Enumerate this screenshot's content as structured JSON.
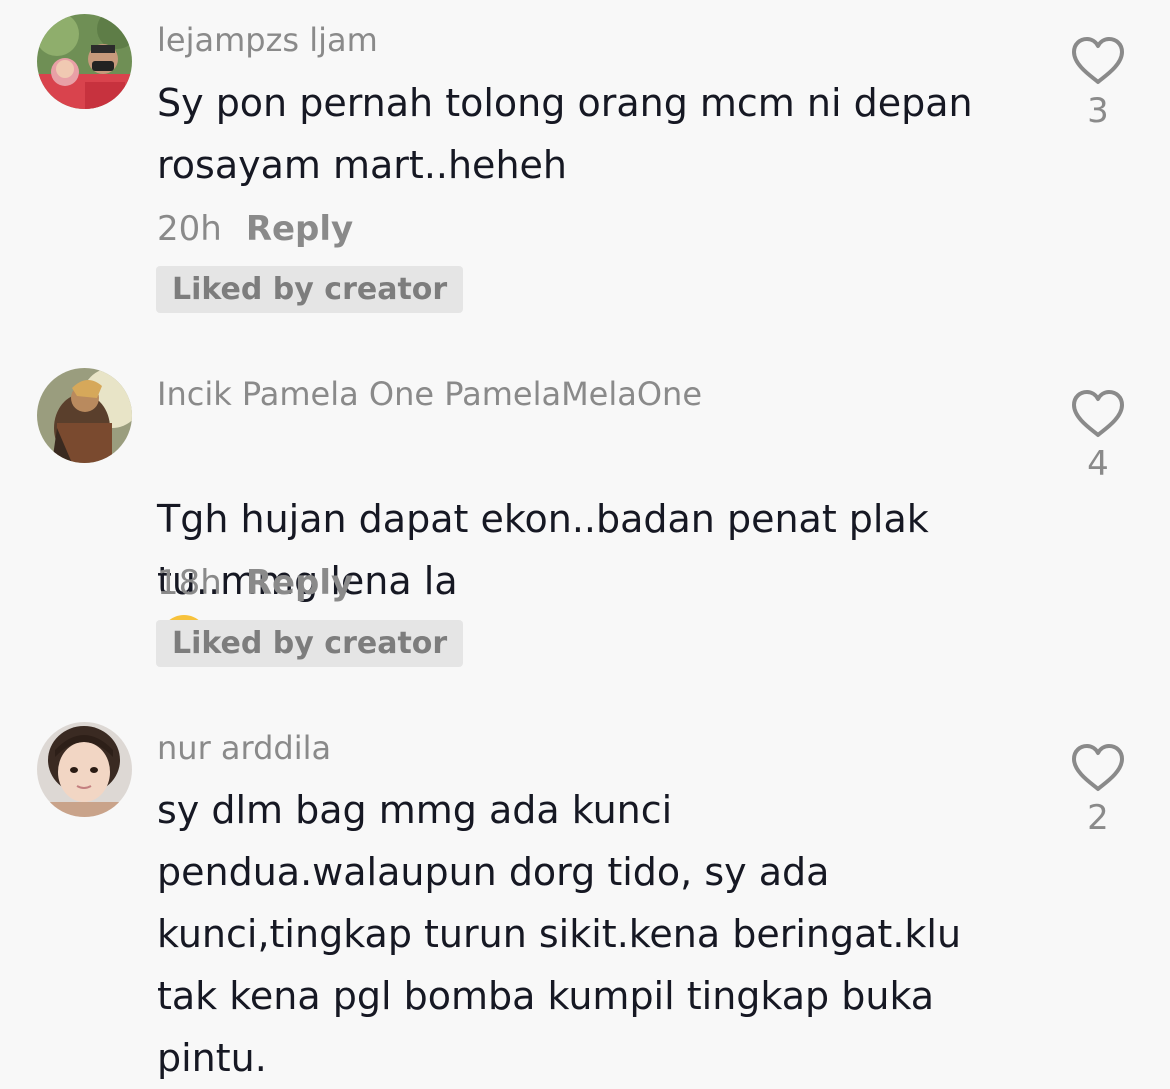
{
  "comments": [
    {
      "username": "lejampzs ljam",
      "text": "Sy pon pernah tolong orang mcm ni depan\nrosayam mart..heheh",
      "time": "20h",
      "reply_label": "Reply",
      "badge": "Liked by creator",
      "likes": "3",
      "avatar": "couple-selfie-avatar"
    },
    {
      "username": "Incik Pamela One PamelaMelaOne",
      "text": "Tgh hujan dapat ekon..badan penat plak\ntu..mmg lena la",
      "emoji": "face-with-tears-of-joy",
      "time": "18h",
      "reply_label": "Reply",
      "badge": "Liked by creator",
      "likes": "4",
      "avatar": "warrior-artwork-avatar"
    },
    {
      "username": "nur arddila",
      "text": "sy dlm bag mmg ada kunci\npendua.walaupun dorg tido, sy ada\nkunci,tingkap turun sikit.kena beringat.klu\ntak kena pgl bomba kumpil tingkap buka\npintu.",
      "likes": "2",
      "avatar": "girl-portrait-avatar"
    }
  ],
  "colors": {
    "background": "#f8f8f8",
    "text": "#161823",
    "muted": "#8a8a8a",
    "badge_bg": "#e5e5e5"
  }
}
